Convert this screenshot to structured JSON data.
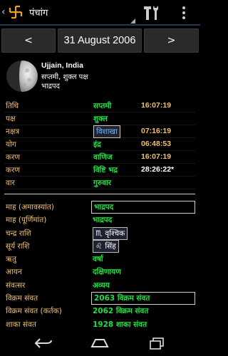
{
  "app": {
    "title": "पंचांग"
  },
  "datebar": {
    "prev_label": "<",
    "date": "31 August 2006",
    "next_label": ">"
  },
  "info": {
    "place": "Ujjain, India",
    "tithi_paksha": "सप्तमी, शुक्ल पक्ष",
    "month": "भाद्रपद"
  },
  "panchang": [
    {
      "label": "तिथि",
      "value": "सप्तमी",
      "time": "16:07:19"
    },
    {
      "label": "पक्ष",
      "value": "शुक्ल",
      "time": ""
    },
    {
      "label": "नक्षत्र",
      "value": "विशाखा",
      "time": "07:16:19"
    },
    {
      "label": "योग",
      "value": "इंद्र",
      "time": "06:48:53"
    },
    {
      "label": "करण",
      "value": "वाणिज",
      "time": "16:07:19"
    },
    {
      "label": "करण",
      "value": "विष्टि भद्र",
      "time": "28:26:22*"
    },
    {
      "label": "वार",
      "value": "गुरुवार",
      "time": ""
    }
  ],
  "details": [
    {
      "label": "माह (अमावस्यांत)",
      "value": "भाद्रपद"
    },
    {
      "label": "माह (पूर्णिमांत)",
      "value": "भाद्रपद"
    },
    {
      "label": "चन्द्र राशि",
      "value": "वृश्चिक",
      "glyph": "♏"
    },
    {
      "label": "सूर्य राशि",
      "value": "सिंह",
      "glyph": "♌"
    },
    {
      "label": "ऋतु",
      "value": "वर्षा"
    },
    {
      "label": "आयन",
      "value": "दक्षिणायण"
    },
    {
      "label": "संवत्सर",
      "value": "अव्यय"
    },
    {
      "label": "विक्रम संवत",
      "value": "2063 विक्रम संवत"
    },
    {
      "label": "विक्रम संवत (कर्तक)",
      "value": "2062 विक्रम संवत"
    },
    {
      "label": "शाका संवत",
      "value": "1928 शाका संवत"
    }
  ],
  "colors": {
    "label": "#f0c070",
    "value": "#22dd44",
    "boxed_value": "#6fb8ff"
  },
  "icons": {
    "logo": "swastika-icon",
    "tools": "tools-icon",
    "overflow": "overflow-menu-icon"
  }
}
